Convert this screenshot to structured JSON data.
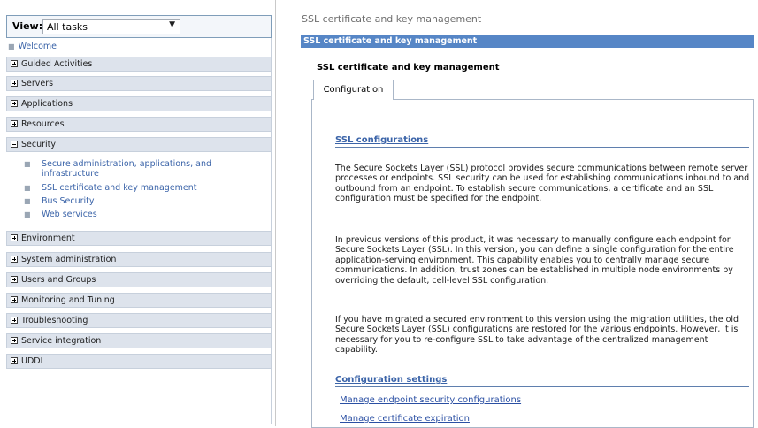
{
  "nav": {
    "view_label": "View:",
    "view_value": "All tasks",
    "welcome": "Welcome",
    "items": [
      {
        "label": "Guided Activities",
        "expanded": false
      },
      {
        "label": "Servers",
        "expanded": false
      },
      {
        "label": "Applications",
        "expanded": false
      },
      {
        "label": "Resources",
        "expanded": false
      },
      {
        "label": "Security",
        "expanded": true
      },
      {
        "label": "Environment",
        "expanded": false
      },
      {
        "label": "System administration",
        "expanded": false
      },
      {
        "label": "Users and Groups",
        "expanded": false
      },
      {
        "label": "Monitoring and Tuning",
        "expanded": false
      },
      {
        "label": "Troubleshooting",
        "expanded": false
      },
      {
        "label": "Service integration",
        "expanded": false
      },
      {
        "label": "UDDI",
        "expanded": false
      }
    ],
    "security_subitems": [
      {
        "line1": "Secure administration, applications, and",
        "line2": "infrastructure"
      },
      {
        "line1": "SSL certificate and key management"
      },
      {
        "line1": "Bus Security"
      },
      {
        "line1": "Web services"
      }
    ]
  },
  "main": {
    "breadcrumb": "SSL certificate and key management",
    "title_bar": "SSL certificate and key management",
    "page_title": "SSL certificate and key management",
    "tab": "Configuration",
    "ssl_heading": "SSL configurations",
    "para1": "The Secure Sockets Layer (SSL) protocol provides secure communications between remote server processes or endpoints. SSL security can be used for establishing communications inbound to and outbound from an endpoint. To establish secure communications, a certificate and an SSL configuration must be specified for the endpoint.",
    "para2": "In previous versions of this product, it was necessary to manually configure each endpoint for Secure Sockets Layer (SSL). In this version, you can define a single configuration for the entire application-serving environment. This capability enables you to centrally manage secure communications. In addition, trust zones can be established in multiple node environments by overriding the default, cell-level SSL configuration.",
    "para3": "If you have migrated a secured environment to this version using the migration utilities, the old Secure Sockets Layer (SSL) configurations are restored for the various endpoints. However, it is necessary for you to re-configure SSL to take advantage of the centralized management capability.",
    "settings_heading": "Configuration settings",
    "links": [
      "Manage endpoint security configurations",
      "Manage certificate expiration"
    ]
  }
}
